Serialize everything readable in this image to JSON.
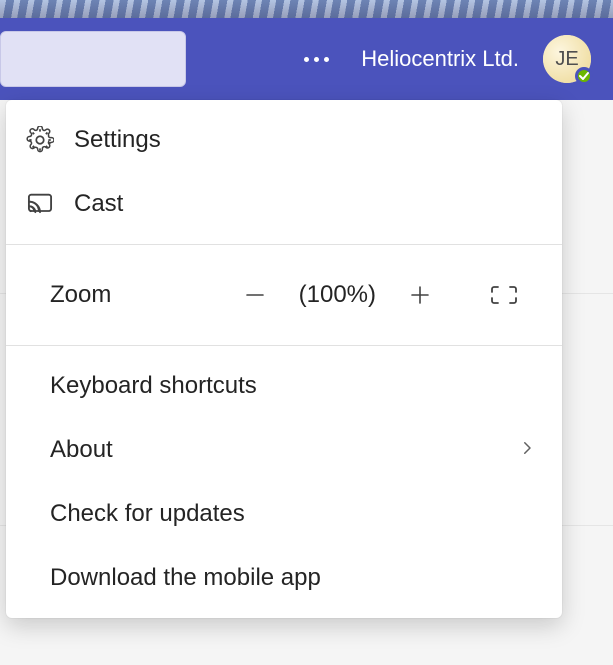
{
  "header": {
    "org_name": "Heliocentrix Ltd.",
    "avatar_initials": "JE"
  },
  "menu": {
    "settings_label": "Settings",
    "cast_label": "Cast",
    "zoom_label": "Zoom",
    "zoom_value": "(100%)",
    "keyboard_shortcuts_label": "Keyboard shortcuts",
    "about_label": "About",
    "check_updates_label": "Check for updates",
    "download_app_label": "Download the mobile app"
  }
}
